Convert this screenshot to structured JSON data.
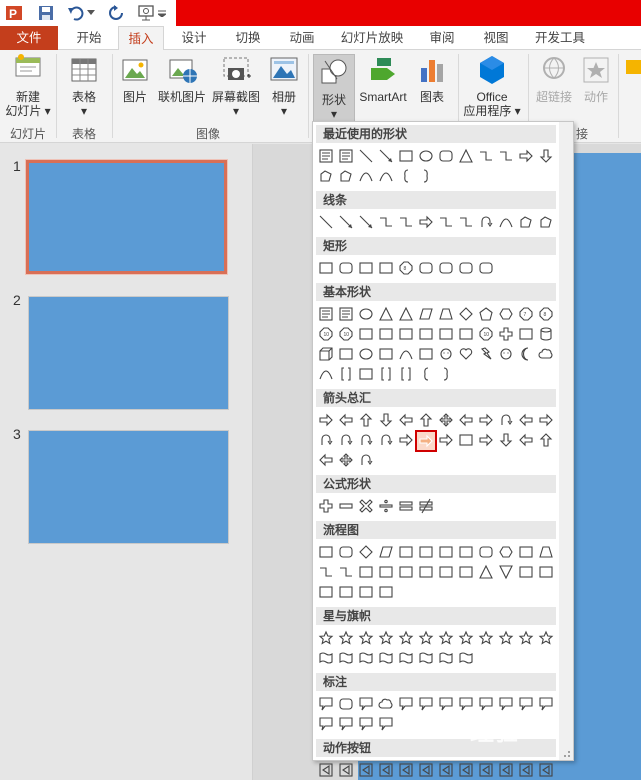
{
  "quick_access": {
    "icons": [
      "powerpoint-logo-icon",
      "save-icon",
      "undo-icon",
      "redo-icon",
      "start-from-beginning-icon"
    ]
  },
  "tabs": [
    {
      "label": "文件",
      "key": "file"
    },
    {
      "label": "开始",
      "key": "home"
    },
    {
      "label": "插入",
      "key": "insert",
      "active": true
    },
    {
      "label": "设计",
      "key": "design"
    },
    {
      "label": "切换",
      "key": "transitions"
    },
    {
      "label": "动画",
      "key": "animations"
    },
    {
      "label": "幻灯片放映",
      "key": "slideshow"
    },
    {
      "label": "审阅",
      "key": "review"
    },
    {
      "label": "视图",
      "key": "view"
    },
    {
      "label": "开发工具",
      "key": "developer"
    }
  ],
  "ribbon": {
    "new_slide": {
      "line1": "新建",
      "line2": "幻灯片 ▾"
    },
    "table": {
      "line1": "表格",
      "line2": "▾"
    },
    "picture": "图片",
    "online_picture": "联机图片",
    "screenshot": {
      "line1": "屏幕截图",
      "line2": "▾"
    },
    "album": {
      "line1": "相册",
      "line2": "▾"
    },
    "shapes": {
      "line1": "形状",
      "line2": "▾"
    },
    "smartart": "SmartArt",
    "chart": "图表",
    "office_apps": {
      "line1": "Office",
      "line2": "应用程序 ▾"
    },
    "hyperlink": "超链接",
    "action": "动作",
    "groups": {
      "slides": "幻灯片",
      "tables": "表格",
      "images": "图像",
      "links": "接"
    }
  },
  "slides": [
    {
      "number": "1",
      "selected": true
    },
    {
      "number": "2",
      "selected": false
    },
    {
      "number": "3",
      "selected": false
    }
  ],
  "shapes_gallery": {
    "sections": [
      {
        "title": "最近使用的形状",
        "rows": [
          [
            "text-box",
            "vertical-text-box",
            "line",
            "arrow-line",
            "rectangle",
            "oval",
            "rounded-rectangle",
            "triangle",
            "elbow-connector",
            "elbow-arrow-connector",
            "right-arrow",
            "down-arrow"
          ],
          [
            "freeform",
            "scribble",
            "arc",
            "curve",
            "left-brace",
            "right-brace"
          ]
        ]
      },
      {
        "title": "线条",
        "rows": [
          [
            "line",
            "arrow-line",
            "double-arrow-line",
            "elbow-connector",
            "elbow-arrow-connector",
            "elbow-double-arrow",
            "curved-connector",
            "curved-arrow-connector",
            "curved-double-arrow",
            "curve",
            "freeform",
            "scribble"
          ]
        ]
      },
      {
        "title": "矩形",
        "rows": [
          [
            "rectangle",
            "rounded-rectangle",
            "snip-single-corner",
            "snip-same-side",
            "snip-diagonal",
            "snip-round",
            "round-single-corner",
            "round-same-side",
            "round-diagonal"
          ]
        ]
      },
      {
        "title": "基本形状",
        "rows": [
          [
            "text-box",
            "vertical-text-box",
            "oval",
            "triangle",
            "right-triangle",
            "parallelogram",
            "trapezoid",
            "diamond",
            "pentagon",
            "hexagon",
            "heptagon",
            "octagon"
          ],
          [
            "decagon",
            "dodecagon",
            "pie",
            "chord",
            "teardrop",
            "frame",
            "half-frame",
            "l-shape",
            "diagonal-stripe",
            "cross",
            "plaque",
            "can"
          ],
          [
            "cube",
            "bevel",
            "donut",
            "no-symbol",
            "block-arc",
            "folded-corner",
            "smiley",
            "heart",
            "lightning",
            "sun",
            "moon",
            "cloud"
          ],
          [
            "arc",
            "double-bracket",
            "double-brace",
            "left-bracket",
            "right-bracket",
            "left-brace",
            "right-brace"
          ]
        ]
      },
      {
        "title": "箭头总汇",
        "rows": [
          [
            "right-arrow",
            "left-arrow",
            "up-arrow",
            "down-arrow",
            "left-right-arrow",
            "up-down-arrow",
            "quad-arrow",
            "left-right-up-arrow",
            "bent-arrow",
            "u-turn-arrow",
            "left-up-arrow",
            "bent-up-arrow"
          ],
          [
            "curved-right-arrow",
            "curved-left-arrow",
            "curved-up-arrow",
            "curved-down-arrow",
            "striped-right-arrow",
            "notched-right-arrow",
            "pentagon-arrow",
            "chevron",
            "right-arrow-callout",
            "down-arrow-callout",
            "left-arrow-callout",
            "up-arrow-callout"
          ],
          [
            "left-right-arrow-callout",
            "quad-arrow-callout",
            "circular-arrow"
          ]
        ],
        "highlight": {
          "row": 1,
          "col": 5
        }
      },
      {
        "title": "公式形状",
        "rows": [
          [
            "plus",
            "minus",
            "multiply",
            "divide",
            "equal",
            "not-equal"
          ]
        ]
      },
      {
        "title": "流程图",
        "rows": [
          [
            "process",
            "alternate-process",
            "decision",
            "data",
            "predefined-process",
            "internal-storage",
            "document",
            "multidocument",
            "terminator",
            "preparation",
            "manual-input",
            "manual-operation"
          ],
          [
            "connector",
            "off-page-connector",
            "card",
            "punched-tape",
            "summing-junction",
            "or",
            "collate",
            "sort",
            "extract",
            "merge",
            "stored-data",
            "delay"
          ],
          [
            "sequential-access-storage",
            "magnetic-disk",
            "direct-access-storage",
            "display"
          ]
        ]
      },
      {
        "title": "星与旗帜",
        "rows": [
          [
            "explosion-1",
            "explosion-2",
            "star-4",
            "star-5",
            "star-6",
            "star-7",
            "star-8",
            "star-10",
            "star-12",
            "star-16",
            "star-24",
            "star-32"
          ],
          [
            "up-ribbon",
            "down-ribbon",
            "curved-up-ribbon",
            "curved-down-ribbon",
            "vertical-scroll",
            "horizontal-scroll",
            "wave",
            "double-wave"
          ]
        ]
      },
      {
        "title": "标注",
        "rows": [
          [
            "rect-callout",
            "rounded-rect-callout",
            "oval-callout",
            "cloud-callout",
            "line-callout-1",
            "line-callout-2",
            "line-callout-3",
            "line-callout-4",
            "line-callout-1-accent",
            "line-callout-2-accent",
            "line-callout-3-accent",
            "line-callout-4-accent"
          ],
          [
            "line-callout-1-border",
            "line-callout-2-border",
            "line-callout-3-border",
            "line-callout-4-border"
          ]
        ]
      },
      {
        "title": "动作按钮",
        "rows": [
          [
            "action-back",
            "action-forward",
            "action-beginning",
            "action-end",
            "action-home",
            "action-information",
            "action-return",
            "action-movie",
            "action-document",
            "action-sound",
            "action-help",
            "action-blank"
          ]
        ]
      }
    ]
  },
  "watermark": "经验"
}
